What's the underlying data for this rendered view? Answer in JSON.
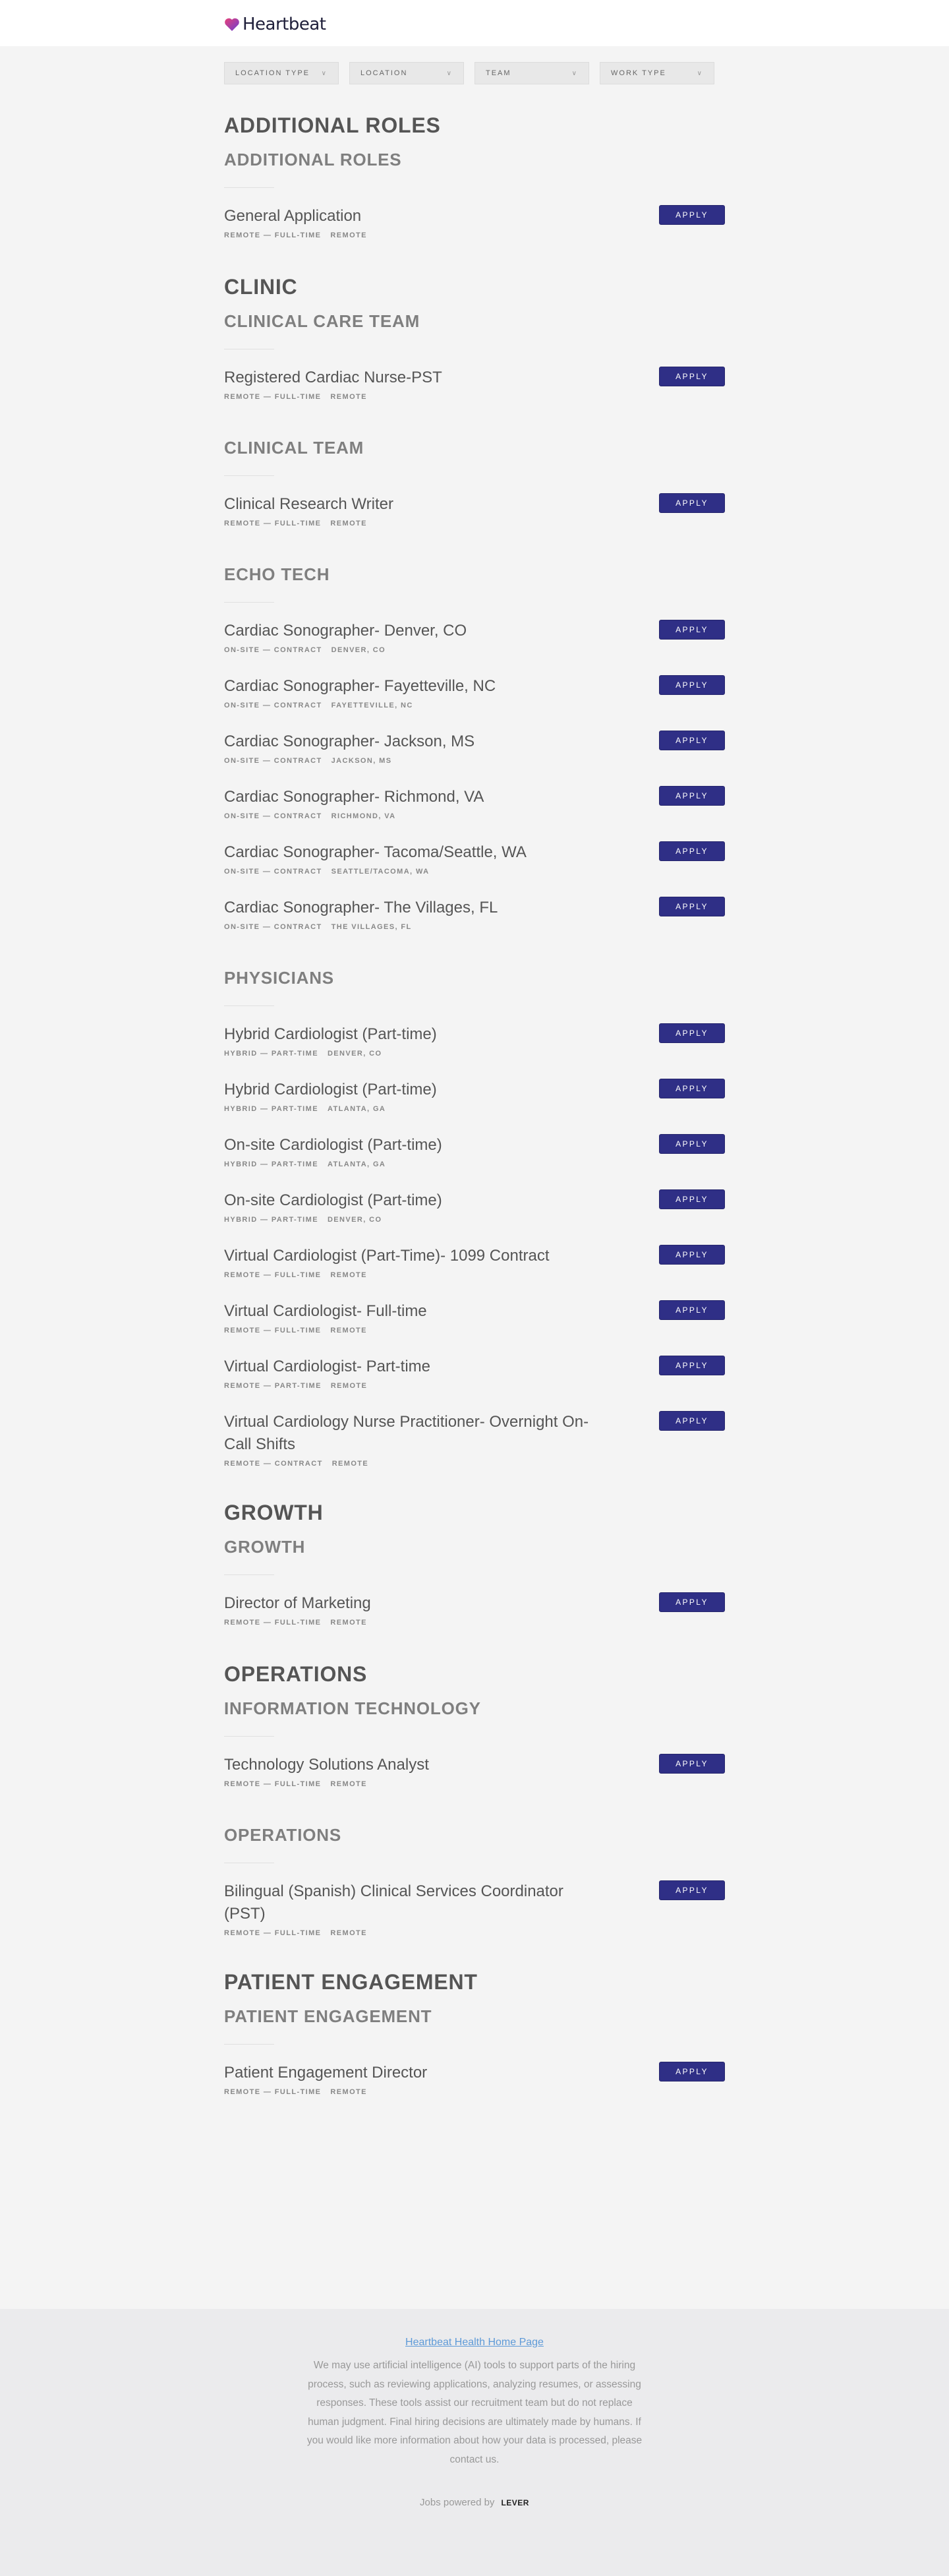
{
  "brand": {
    "name": "Heartbeat",
    "accent": "#2f2f86"
  },
  "filters": [
    {
      "label": "Location Type",
      "icon": "chevron-down-icon"
    },
    {
      "label": "Location",
      "icon": "chevron-down-icon"
    },
    {
      "label": "Team",
      "icon": "chevron-down-icon"
    },
    {
      "label": "Work Type",
      "icon": "chevron-down-icon"
    }
  ],
  "apply_label": "Apply",
  "teams": [
    {
      "name": "Additional Roles",
      "departments": [
        {
          "name": "Additional Roles",
          "postings": [
            {
              "title": "General Application",
              "commitment": "Remote — Full-time",
              "location": "Remote"
            }
          ]
        }
      ]
    },
    {
      "name": "Clinic",
      "departments": [
        {
          "name": "Clinical Care Team",
          "postings": [
            {
              "title": "Registered Cardiac Nurse-PST",
              "commitment": "Remote — Full-time",
              "location": "Remote"
            }
          ]
        },
        {
          "name": "Clinical Team",
          "postings": [
            {
              "title": "Clinical Research Writer",
              "commitment": "Remote — Full-time",
              "location": "Remote"
            }
          ]
        },
        {
          "name": "Echo Tech",
          "postings": [
            {
              "title": "Cardiac Sonographer- Denver, CO",
              "commitment": "On-site — Contract",
              "location": "Denver, CO"
            },
            {
              "title": "Cardiac Sonographer- Fayetteville, NC",
              "commitment": "On-site — Contract",
              "location": "Fayetteville, NC"
            },
            {
              "title": "Cardiac Sonographer- Jackson, MS",
              "commitment": "On-site — Contract",
              "location": "Jackson, MS"
            },
            {
              "title": "Cardiac Sonographer- Richmond, VA",
              "commitment": "On-site — Contract",
              "location": "Richmond, VA"
            },
            {
              "title": "Cardiac Sonographer- Tacoma/Seattle, WA",
              "commitment": "On-site — Contract",
              "location": "Seattle/Tacoma, WA"
            },
            {
              "title": "Cardiac Sonographer- The Villages, FL",
              "commitment": "On-site — Contract",
              "location": "The Villages, FL"
            }
          ]
        },
        {
          "name": "Physicians",
          "postings": [
            {
              "title": "Hybrid Cardiologist (Part-time)",
              "commitment": "Hybrid — Part-time",
              "location": "Denver, CO"
            },
            {
              "title": "Hybrid Cardiologist (Part-time)",
              "commitment": "Hybrid — Part-time",
              "location": "Atlanta, GA"
            },
            {
              "title": "On-site Cardiologist (Part-time)",
              "commitment": "Hybrid — Part-time",
              "location": "Atlanta, GA"
            },
            {
              "title": "On-site Cardiologist (Part-time)",
              "commitment": "Hybrid — Part-time",
              "location": "Denver, CO"
            },
            {
              "title": "Virtual Cardiologist (Part-Time)- 1099 Contract",
              "commitment": "Remote — Full-time",
              "location": "Remote"
            },
            {
              "title": "Virtual Cardiologist- Full-time",
              "commitment": "Remote — Full-time",
              "location": "Remote"
            },
            {
              "title": "Virtual Cardiologist- Part-time",
              "commitment": "Remote — Part-time",
              "location": "Remote"
            },
            {
              "title": "Virtual Cardiology Nurse Practitioner- Overnight On-Call Shifts",
              "commitment": "Remote — Contract",
              "location": "Remote"
            }
          ]
        }
      ]
    },
    {
      "name": "Growth",
      "departments": [
        {
          "name": "Growth",
          "postings": [
            {
              "title": "Director of Marketing",
              "commitment": "Remote — Full-time",
              "location": "Remote"
            }
          ]
        }
      ]
    },
    {
      "name": "Operations",
      "departments": [
        {
          "name": "Information Technology",
          "postings": [
            {
              "title": "Technology Solutions Analyst",
              "commitment": "Remote — Full-time",
              "location": "Remote"
            }
          ]
        },
        {
          "name": "Operations",
          "postings": [
            {
              "title": "Bilingual (Spanish) Clinical Services Coordinator (PST)",
              "commitment": "Remote — Full-time",
              "location": "Remote"
            }
          ]
        }
      ]
    },
    {
      "name": "Patient Engagement",
      "departments": [
        {
          "name": "Patient Engagement",
          "postings": [
            {
              "title": "Patient Engagement Director",
              "commitment": "Remote — Full-time",
              "location": "Remote"
            }
          ]
        }
      ]
    }
  ],
  "footer": {
    "home_link": "Heartbeat Health Home Page",
    "disclaimer": "We may use artificial intelligence (AI) tools to support parts of the hiring process, such as reviewing applications, analyzing resumes, or assessing responses. These tools assist our recruitment team but do not replace human judgment. Final hiring decisions are ultimately made by humans. If you would like more information about how your data is processed, please contact us.",
    "powered_by": "Jobs powered by",
    "powered_logo": "LEVER"
  }
}
